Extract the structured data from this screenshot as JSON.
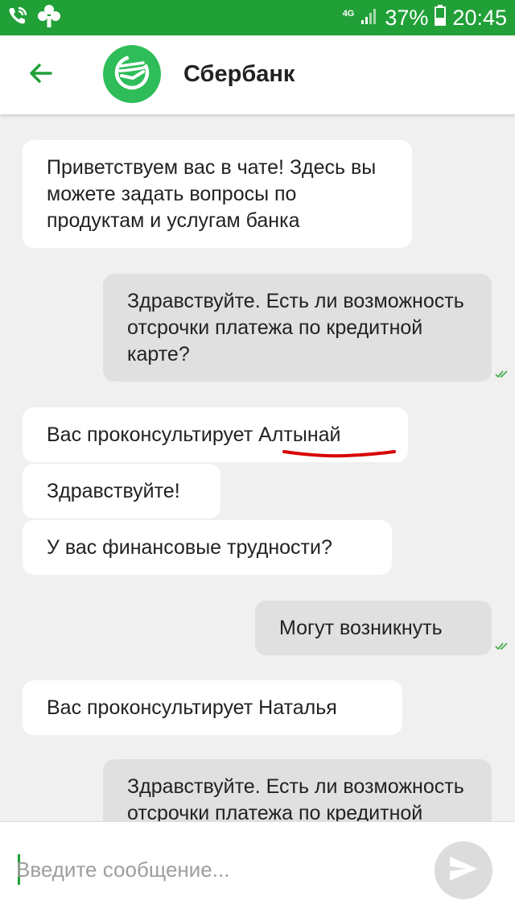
{
  "status_bar": {
    "network": "4G",
    "battery": "37%",
    "time": "20:45",
    "icons": [
      "wifi-call-icon",
      "tree-icon",
      "signal-icon",
      "battery-icon"
    ]
  },
  "header": {
    "back_icon": "arrow-left-icon",
    "logo_icon": "sberbank-logo-icon",
    "title": "Сбербанк"
  },
  "messages": [
    {
      "direction": "in",
      "text": "Приветствуем вас в чате! Здесь вы можете задать вопросы по продуктам и услугам банка"
    },
    {
      "direction": "out",
      "text": "Здравствуйте. Есть ли возможность отсрочки платежа по кредитной карте?",
      "status": "read"
    },
    {
      "direction": "in",
      "text": "Вас проконсультирует Алтынай"
    },
    {
      "direction": "in",
      "text": "Здравствуйте!"
    },
    {
      "direction": "in",
      "text": "У вас финансовые трудности?"
    },
    {
      "direction": "out",
      "text": "Могут возникнуть",
      "status": "read"
    },
    {
      "direction": "in",
      "text": "Вас проконсультирует Наталья"
    },
    {
      "direction": "out",
      "text": "Здравствуйте. Есть ли возможность отсрочки платежа по кредитной карте?"
    }
  ],
  "input": {
    "value": "",
    "placeholder": "Введите сообщение..."
  },
  "send_icon": "send-icon",
  "colors": {
    "brand": "#21a038",
    "logo": "#2ebd59",
    "incoming_bubble": "#ffffff",
    "outgoing_bubble": "#e0e0e0",
    "read_ticks": "#4caf50",
    "annotation": "#d80000"
  }
}
